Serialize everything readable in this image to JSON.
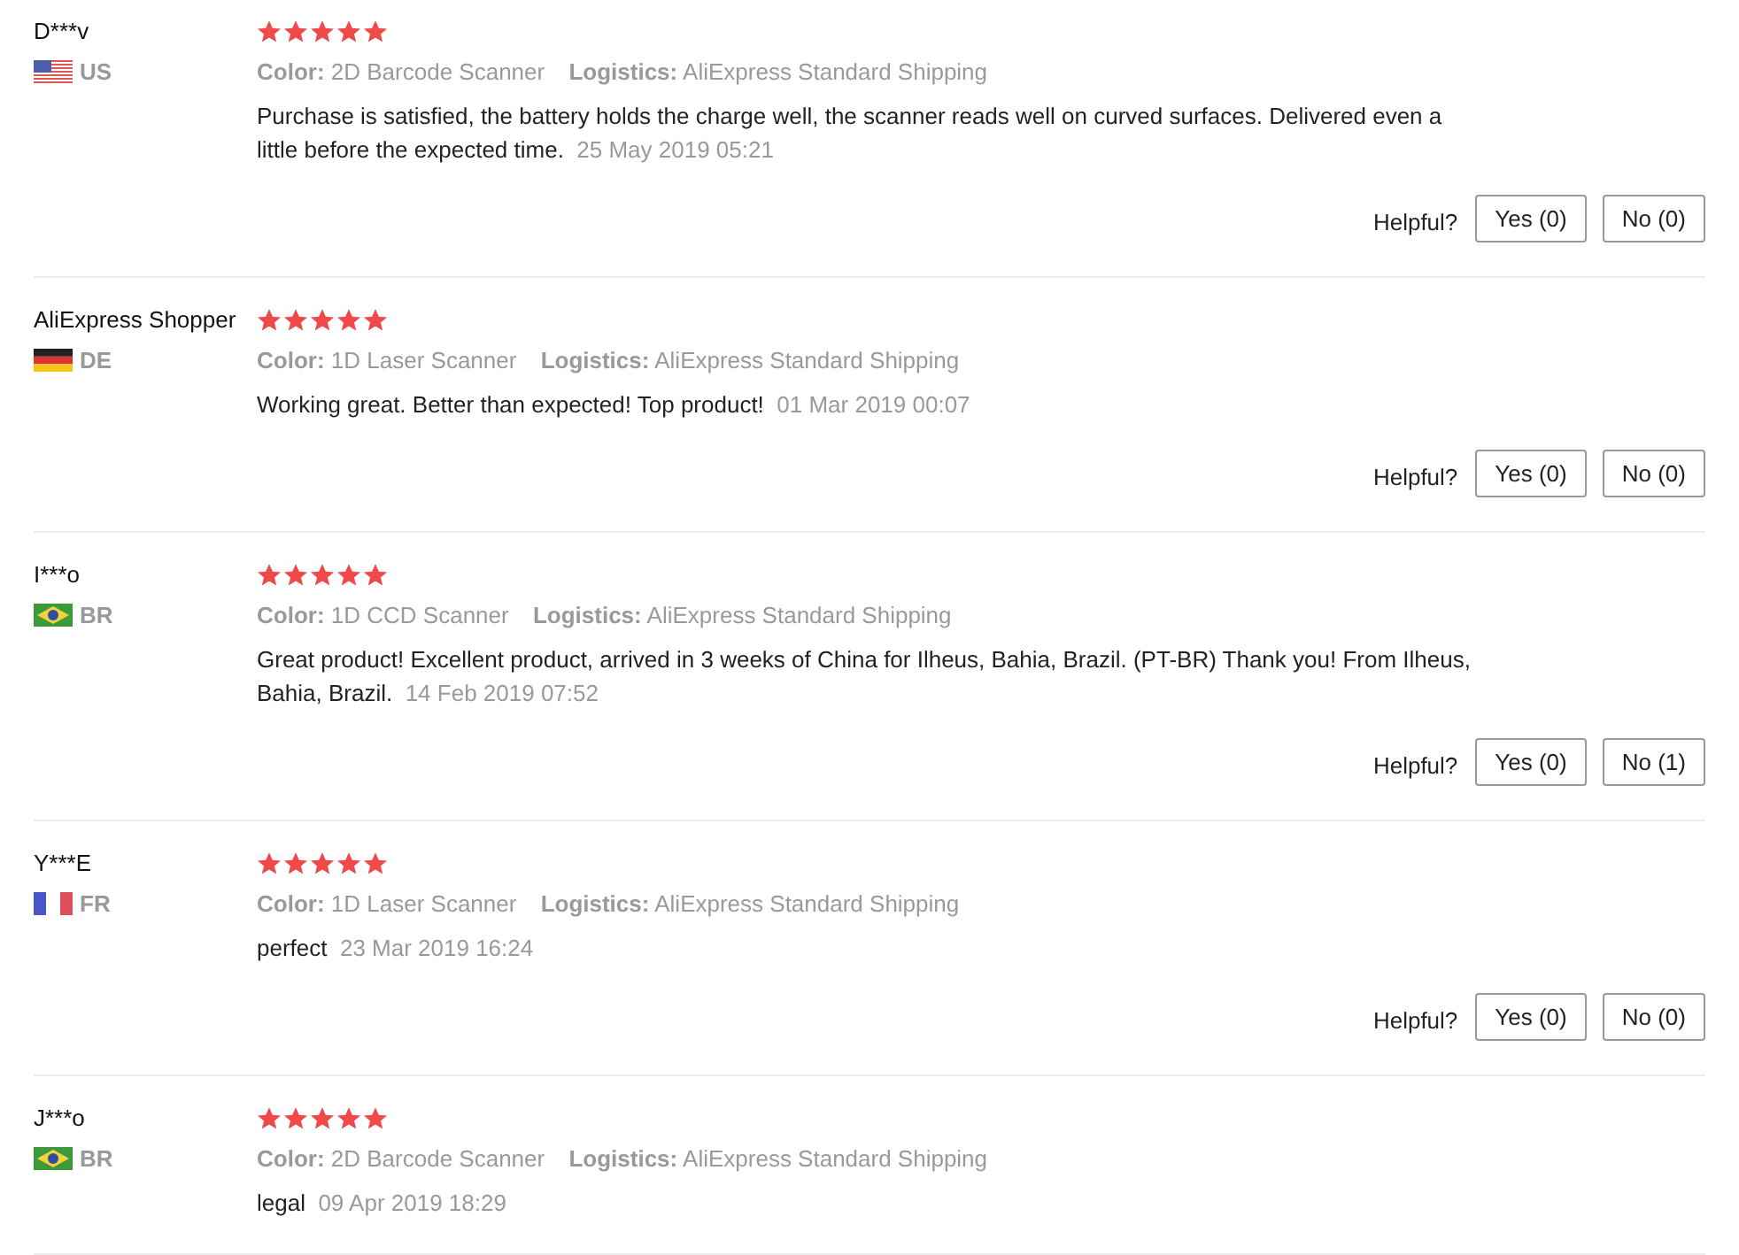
{
  "reviews": [
    {
      "name": "D***v",
      "kind": "us",
      "country": "US",
      "stars": 5,
      "color_label": "Color:",
      "variant": "2D Barcode Scanner",
      "logistics_label": "Logistics:",
      "logistics": "AliExpress Standard Shipping",
      "text": "Purchase is satisfied, the battery holds the charge well, the scanner reads well on curved surfaces. Delivered even a little before the expected time.",
      "date": "25 May 2019 05:21",
      "helpful": "Helpful?",
      "yes": "Yes (0)",
      "no": "No (0)"
    },
    {
      "name": "AliExpress Shopper",
      "kind": "de",
      "country": "DE",
      "stars": 5,
      "color_label": "Color:",
      "variant": "1D Laser Scanner",
      "logistics_label": "Logistics:",
      "logistics": "AliExpress Standard Shipping",
      "text": "Working great. Better than expected! Top product!",
      "date": "01 Mar 2019 00:07",
      "helpful": "Helpful?",
      "yes": "Yes (0)",
      "no": "No (0)"
    },
    {
      "name": "I***o",
      "kind": "br",
      "country": "BR",
      "stars": 5,
      "color_label": "Color:",
      "variant": "1D CCD Scanner",
      "logistics_label": "Logistics:",
      "logistics": "AliExpress Standard Shipping",
      "text": "Great product! Excellent product, arrived in 3 weeks of China for Ilheus, Bahia, Brazil. (PT-BR) Thank you! From Ilheus, Bahia, Brazil.",
      "date": "14 Feb 2019 07:52",
      "helpful": "Helpful?",
      "yes": "Yes (0)",
      "no": "No (1)"
    },
    {
      "name": "Y***E",
      "kind": "fr",
      "country": "FR",
      "stars": 5,
      "color_label": "Color:",
      "variant": "1D Laser Scanner",
      "logistics_label": "Logistics:",
      "logistics": "AliExpress Standard Shipping",
      "text": "perfect",
      "date": "23 Mar 2019 16:24",
      "helpful": "Helpful?",
      "yes": "Yes (0)",
      "no": "No (0)"
    },
    {
      "name": "J***o",
      "kind": "br",
      "country": "BR",
      "stars": 5,
      "color_label": "Color:",
      "variant": "2D Barcode Scanner",
      "logistics_label": "Logistics:",
      "logistics": "AliExpress Standard Shipping",
      "text": "legal",
      "date": "09 Apr 2019 18:29"
    }
  ]
}
